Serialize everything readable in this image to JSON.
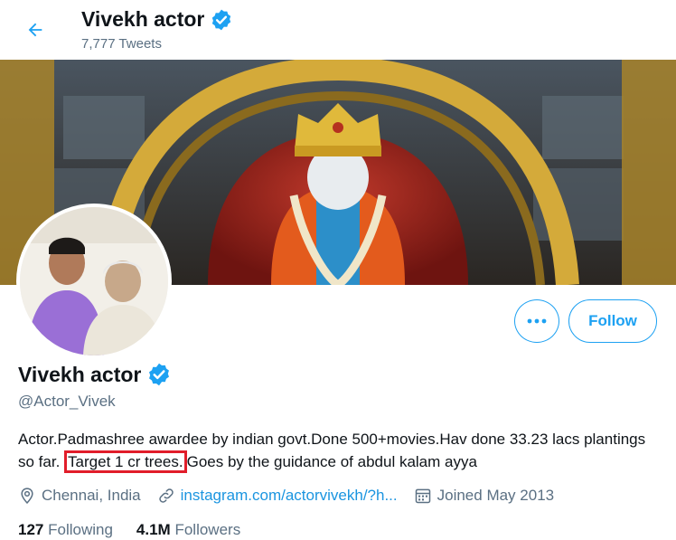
{
  "header": {
    "name": "Vivekh actor",
    "tweet_count": "7,777 Tweets"
  },
  "profile": {
    "name": "Vivekh actor",
    "handle": "@Actor_Vivek",
    "bio_part1": "Actor.Padmashree awardee by indian govt.Done 500+movies.Hav done 33.23 lacs plantings so far.",
    "bio_highlight": "Target 1 cr trees.",
    "bio_part2": "Goes by the guidance of abdul kalam ayya",
    "location": "Chennai, India",
    "website": "instagram.com/actorvivekh/?h...",
    "joined": "Joined May 2013",
    "following_count": "127",
    "following_label": "Following",
    "followers_count": "4.1M",
    "followers_label": "Followers"
  },
  "actions": {
    "follow_label": "Follow"
  },
  "icons": {
    "back": "arrow-left-icon",
    "verified": "verified-badge-icon",
    "more": "more-dots-icon",
    "location": "location-pin-icon",
    "link": "link-icon",
    "calendar": "calendar-icon"
  },
  "colors": {
    "accent": "#1da1f2",
    "link": "#1b95e0",
    "secondary_text": "#5b7083",
    "highlight_box": "#e11d2a"
  }
}
